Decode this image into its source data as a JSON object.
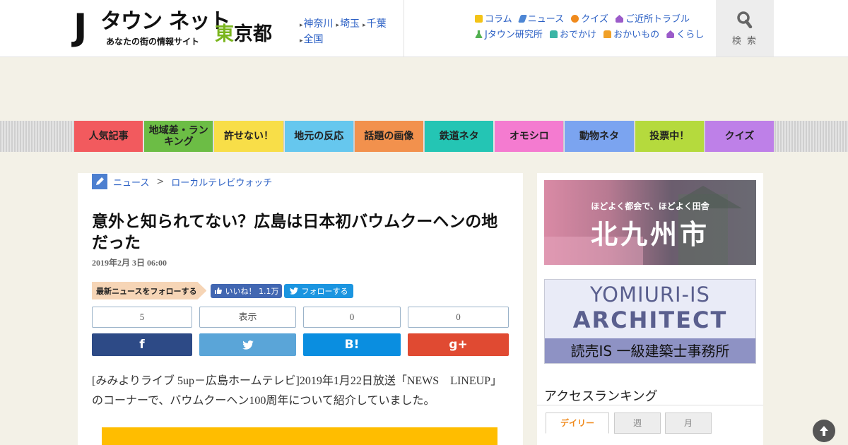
{
  "header": {
    "logo": {
      "j": "J",
      "main": "タウン ネット",
      "sub": "あなたの街の情報サイト",
      "pref_first": "東",
      "pref_rest": "京都"
    },
    "regions": [
      "神奈川",
      "埼玉",
      "千葉",
      "全国"
    ],
    "toplinks_row1": [
      {
        "label": "コラム",
        "icon": "column-icon",
        "color": "#f3c317"
      },
      {
        "label": "ニュース",
        "icon": "pencil-icon",
        "color": "#4d86d4"
      },
      {
        "label": "クイズ",
        "icon": "quiz-icon",
        "color": "#f08a1c"
      },
      {
        "label": "ご近所トラブル",
        "icon": "house-icon",
        "color": "#9b5bc9"
      }
    ],
    "toplinks_row2": [
      {
        "label": "Jタウン研究所",
        "icon": "flask-icon",
        "color": "#52b051"
      },
      {
        "label": "おでかけ",
        "icon": "car-icon",
        "color": "#3bb5a5"
      },
      {
        "label": "おかいもの",
        "icon": "bag-icon",
        "color": "#f0a027"
      },
      {
        "label": "くらし",
        "icon": "home-icon",
        "color": "#9b5bc9"
      }
    ],
    "search_label": "検 索"
  },
  "categories": [
    {
      "label": "人気記事",
      "color": "#f25a5e"
    },
    {
      "label": "地域差・ランキング",
      "color": "#6cbd45"
    },
    {
      "label": "許せない！",
      "color": "#f8de48"
    },
    {
      "label": "地元の反応",
      "color": "#66c7ee"
    },
    {
      "label": "話題の画像",
      "color": "#f2914d"
    },
    {
      "label": "鉄道ネタ",
      "color": "#24c5b4"
    },
    {
      "label": "オモシロ",
      "color": "#f47bd0"
    },
    {
      "label": "動物ネタ",
      "color": "#7ba4f0"
    },
    {
      "label": "投票中！",
      "color": "#b5da3d"
    },
    {
      "label": "クイズ",
      "color": "#be80e8"
    }
  ],
  "breadcrumb": {
    "section": "ニュース",
    "separator": ">",
    "sub": "ローカルテレビウォッチ"
  },
  "article": {
    "title": "意外と知られてない？広島は日本初バウムクーヘンの地だった",
    "date": "2019年2月 3日 06:00",
    "follow_label": "最新ニュースをフォローする",
    "fb_like_label": "いいね！ 1.1万",
    "tw_follow_label": "フォローする",
    "counts": [
      "5",
      "表示",
      "0",
      "0"
    ],
    "share_buttons": [
      {
        "label": "f",
        "color": "#2d4a86"
      },
      {
        "label": "",
        "color": "#5aa5d8"
      },
      {
        "label": "B!",
        "color": "#0a8ee0"
      },
      {
        "label": "g+",
        "color": "#e04a32"
      }
    ],
    "body": "[みみよりライブ 5up－広島ホームテレビ]2019年1月22日放送「NEWS　LINEUP」のコーナーで、バウムクーヘン100周年について紹介していました。"
  },
  "sidebar": {
    "ad1": {
      "caption": "ほどよく都会で、ほどよく田舎",
      "headline": "北九州市"
    },
    "ad2": {
      "line1": "YOMIURI-IS",
      "line2": "ARCHITECT",
      "line3": "読売IS 一級建築士事務所"
    },
    "ranking_title": "アクセスランキング",
    "ranking_tabs": [
      "デイリー",
      "週",
      "月"
    ]
  }
}
